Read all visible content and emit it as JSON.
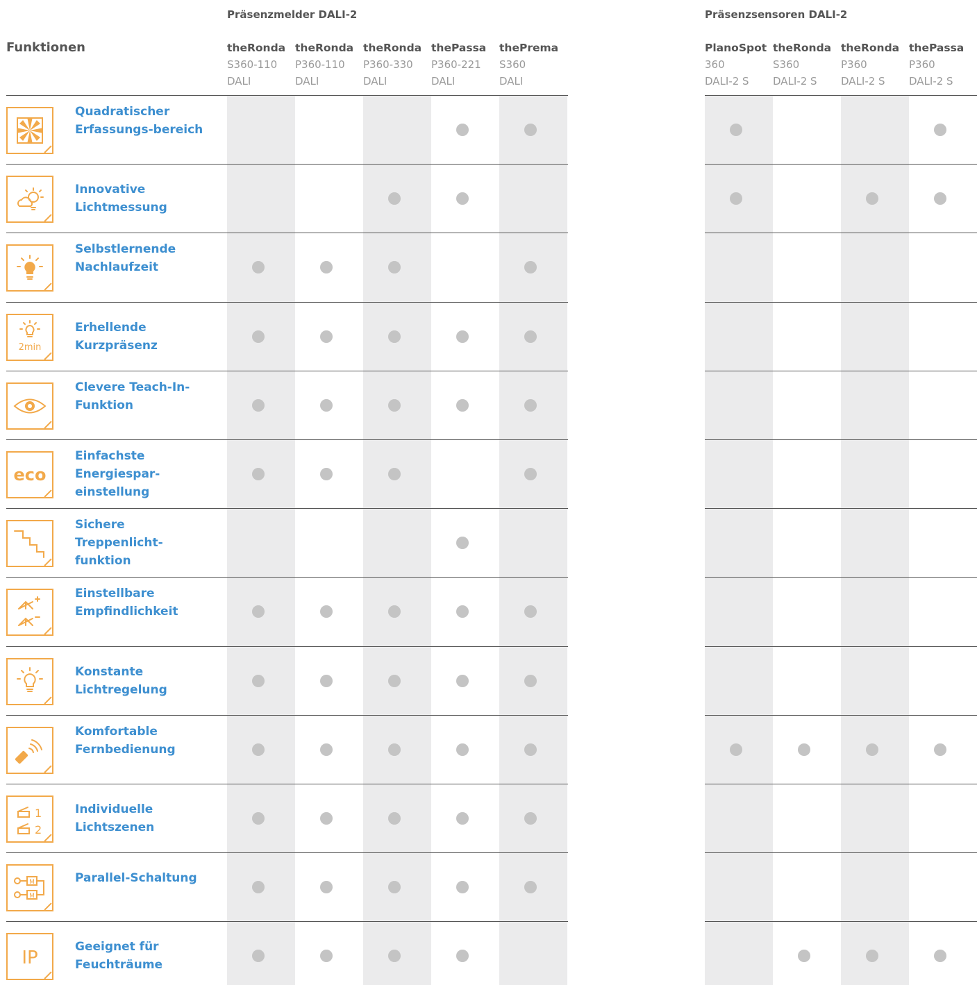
{
  "groups": {
    "left_title": "Präsenzmelder DALI-2",
    "right_title": "Präsenzsensoren DALI-2"
  },
  "functions_header": "Funktionen",
  "columns": [
    {
      "name": "theRonda",
      "model": "S360-110",
      "variant": "DALI"
    },
    {
      "name": "theRonda",
      "model": "P360-110",
      "variant": "DALI"
    },
    {
      "name": "theRonda",
      "model": "P360-330",
      "variant": "DALI"
    },
    {
      "name": "thePassa",
      "model": "P360-221",
      "variant": "DALI"
    },
    {
      "name": "thePrema",
      "model": "S360",
      "variant": "DALI"
    },
    {
      "name": "PlanoSpot",
      "model": "360",
      "variant": "DALI-2 S"
    },
    {
      "name": "theRonda",
      "model": "S360",
      "variant": "DALI-2 S"
    },
    {
      "name": "theRonda",
      "model": "P360",
      "variant": "DALI-2 S"
    },
    {
      "name": "thePassa",
      "model": "P360",
      "variant": "DALI-2 S"
    }
  ],
  "rows": [
    {
      "label": "Quadratischer Erfassungs-bereich",
      "icon": "square-detection-icon",
      "dots": [
        0,
        0,
        0,
        1,
        1,
        1,
        0,
        0,
        1
      ]
    },
    {
      "label": "Innovative Lichtmessung",
      "icon": "cloud-sun-icon",
      "dots": [
        0,
        0,
        1,
        1,
        0,
        1,
        0,
        1,
        1
      ]
    },
    {
      "label": "Selbstlernende Nachlaufzeit",
      "icon": "lightbulb-filled-icon",
      "dots": [
        1,
        1,
        1,
        0,
        1,
        0,
        0,
        0,
        0
      ]
    },
    {
      "label": "Erhellende Kurzpräsenz",
      "icon": "lightbulb-2min-icon",
      "icon_text": "2min",
      "dots": [
        1,
        1,
        1,
        1,
        1,
        0,
        0,
        0,
        0
      ]
    },
    {
      "label": "Clevere Teach-In-Funktion",
      "icon": "eye-icon",
      "dots": [
        1,
        1,
        1,
        1,
        1,
        0,
        0,
        0,
        0
      ]
    },
    {
      "label": "Einfachste Energiespar-einstellung",
      "icon": "eco-icon",
      "icon_text": "eco",
      "dots": [
        1,
        1,
        1,
        0,
        1,
        0,
        0,
        0,
        0
      ]
    },
    {
      "label": "Sichere Treppenlicht-funktion",
      "icon": "stairs-icon",
      "dots": [
        0,
        0,
        0,
        1,
        0,
        0,
        0,
        0,
        0
      ]
    },
    {
      "label": "Einstellbare Empfindlichkeit",
      "icon": "sensitivity-icon",
      "dots": [
        1,
        1,
        1,
        1,
        1,
        0,
        0,
        0,
        0
      ]
    },
    {
      "label": "Konstante Lichtregelung",
      "icon": "lightbulb-outline-icon",
      "dots": [
        1,
        1,
        1,
        1,
        1,
        0,
        0,
        0,
        0
      ]
    },
    {
      "label": "Komfortable Fernbedienung",
      "icon": "remote-control-icon",
      "dots": [
        1,
        1,
        1,
        1,
        1,
        1,
        1,
        1,
        1
      ]
    },
    {
      "label": "Individuelle Lichtszenen",
      "icon": "light-scenes-icon",
      "icon_text_1": "1",
      "icon_text_2": "2",
      "dots": [
        1,
        1,
        1,
        1,
        1,
        0,
        0,
        0,
        0
      ]
    },
    {
      "label": "Parallel-Schaltung",
      "icon": "parallel-circuit-icon",
      "icon_text": "M",
      "dots": [
        1,
        1,
        1,
        1,
        1,
        0,
        0,
        0,
        0
      ]
    },
    {
      "label": "Geeignet für Feuchträume",
      "icon": "ip-icon",
      "icon_text": "IP",
      "dots": [
        1,
        1,
        1,
        1,
        0,
        0,
        1,
        1,
        1
      ]
    }
  ],
  "colors": {
    "accent": "#f2a94a",
    "label": "#3d8fd0",
    "dot": "#c4c4c4",
    "stripe": "#ebebec"
  }
}
